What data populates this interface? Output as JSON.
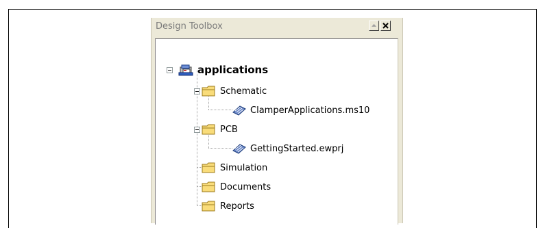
{
  "panel": {
    "title": "Design Toolbox",
    "pin_icon": "pin-icon",
    "close_icon": "close-icon"
  },
  "tree": {
    "root": {
      "label": "applications",
      "icon": "project-icon"
    },
    "schematic": {
      "label": "Schematic",
      "icon": "folder-icon"
    },
    "schematic_file": {
      "label": "ClamperApplications.ms10",
      "icon": "design-file-icon"
    },
    "pcb": {
      "label": "PCB",
      "icon": "folder-icon"
    },
    "pcb_file": {
      "label": "GettingStarted.ewprj",
      "icon": "design-file-icon"
    },
    "simulation": {
      "label": "Simulation",
      "icon": "folder-icon"
    },
    "documents": {
      "label": "Documents",
      "icon": "folder-icon"
    },
    "reports": {
      "label": "Reports",
      "icon": "folder-icon"
    }
  },
  "colors": {
    "panel_bg": "#ece9d8",
    "folder_fill": "#f9dc7a",
    "folder_stroke": "#9c7b1e"
  }
}
